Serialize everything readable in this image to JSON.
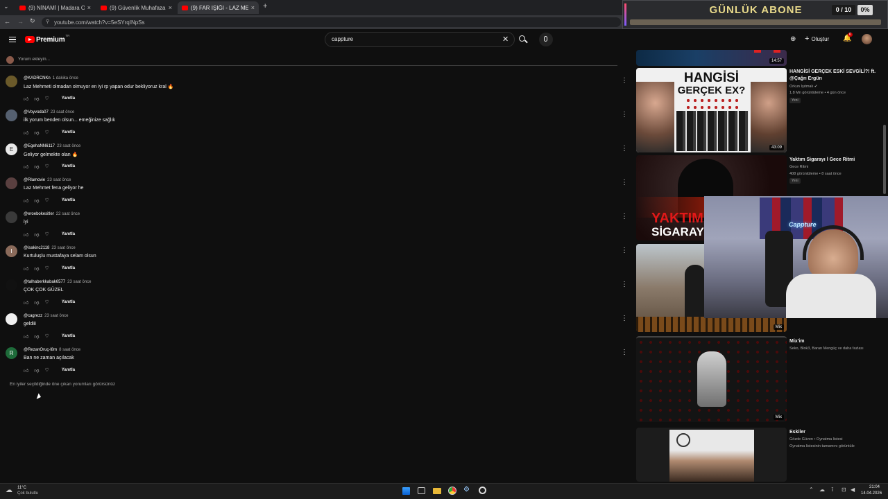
{
  "browser": {
    "tabs": [
      {
        "title": "(9) NİNAMİ | Madara Olduk #0"
      },
      {
        "title": "(9) Güvenlik Muhafaza Türkiye 2"
      },
      {
        "title": "(9) FAR IŞIĞI - LAZ MEHMET GE"
      }
    ],
    "url": "youtube.com/watch?v=5eSYrqINpSs"
  },
  "overlay": {
    "title": "GÜNLÜK ABONE",
    "count": "0 / 10",
    "percent": "0%",
    "progress": 0
  },
  "youtube": {
    "logo_text": "Premium",
    "logo_sup": "TR",
    "search_query": "cappture",
    "create_label": "Oluştur",
    "notif_count": "6",
    "add_comment_placeholder": "Yorum ekleyin..."
  },
  "comments": [
    {
      "author": "@KADRCNKn",
      "time": "1 dakika önce",
      "text": "Laz Mehmeti olmadan olmuyor en iyi rp yapan odur bekliyoruz kral 🔥",
      "reply": "Yanıtla",
      "avatar_color": "#6b5a2a",
      "avatar_letter": ""
    },
    {
      "author": "@Voyvoda07",
      "time": "23 saat önce",
      "text": "ilk yorum benden olsun... emeğinize sağlık",
      "reply": "Yanıtla",
      "avatar_color": "#556070",
      "avatar_letter": ""
    },
    {
      "author": "@EgehaNN6117",
      "time": "23 saat önce",
      "text": "Geliyor gelmekte olan 🔥",
      "reply": "Yanıtla",
      "avatar_color": "#e8e8e8",
      "avatar_letter": "E"
    },
    {
      "author": "@Rlamovie",
      "time": "23 saat önce",
      "text": "Laz Mehmet fena geliyor he",
      "reply": "Yanıtla",
      "avatar_color": "#5a4040",
      "avatar_letter": ""
    },
    {
      "author": "@eroebokesitler",
      "time": "22 saat önce",
      "text": "iyi",
      "reply": "Yanıtla",
      "avatar_color": "#3a3a3a",
      "avatar_letter": ""
    },
    {
      "author": "@isakinc2118",
      "time": "23 saat önce",
      "text": "Kurtuluşlu mustafaya selam olsun",
      "reply": "Yanıtla",
      "avatar_color": "#8a6a5a",
      "avatar_letter": "I"
    },
    {
      "author": "@talhaberkkabak6577",
      "time": "23 saat önce",
      "text": "ÇOK ÇOK GÜZEL",
      "reply": "Yanıtla",
      "avatar_color": "#111111",
      "avatar_letter": ""
    },
    {
      "author": "@cagrezz",
      "time": "23 saat önce",
      "text": "geldiii",
      "reply": "Yanıtla",
      "avatar_color": "#f0f0f0",
      "avatar_letter": ""
    },
    {
      "author": "@RezanOruç-l8m",
      "time": "8 saat önce",
      "text": "Ban ne zaman açılacak",
      "reply": "Yanıtla",
      "avatar_color": "#1e6b3a",
      "avatar_letter": "R"
    }
  ],
  "comments_footer": "En iyiler seçildiğinde öne çıkan yorumları görürsünüz",
  "sidebar": {
    "top_duration": "14:57",
    "videos": [
      {
        "title": "HANGİSİ GERÇEK ESKİ SEVGİLİ?! ft. @Çağrı Ergün",
        "channel": "Orkun Işıtmak",
        "meta": "1,8 Mn görüntüleme • 4 gün önce",
        "badge": "Yeni",
        "duration": "43:09",
        "thumb_text_1": "HANGİSİ",
        "thumb_text_2": "GERÇEK EX?"
      },
      {
        "title": "Yaktım Sigarayı l Gece Ritmi",
        "channel": "Gece Ritmi",
        "meta": "408 görüntüleme • 8 saat önce",
        "badge": "Yeni",
        "duration": "",
        "thumb_text_1": "YAKTIM",
        "thumb_text_2": "SİGARAYI"
      },
      {
        "title": "",
        "channel": "",
        "meta": "",
        "badge": "",
        "duration": "Mix",
        "thumb_text_1": "",
        "thumb_text_2": ""
      },
      {
        "title": "Mix'im",
        "channel": "Seko, Blok3, Baran Mengüç ve daha fazlası",
        "meta": "",
        "badge": "",
        "duration": "Mix",
        "thumb_text_1": "",
        "thumb_text_2": ""
      },
      {
        "title": "Eskiler",
        "channel": "Gözde Güven • Oynatma listesi",
        "meta": "Oynatma listesinin tamamını görüntüle",
        "badge": "",
        "duration": "",
        "thumb_text_1": "",
        "thumb_text_2": ""
      }
    ]
  },
  "webcam": {
    "sign": "Cappture"
  },
  "taskbar": {
    "temp": "11°C",
    "weather": "Çok bulutlu",
    "time": "21:04",
    "date": "14.04.2026"
  }
}
